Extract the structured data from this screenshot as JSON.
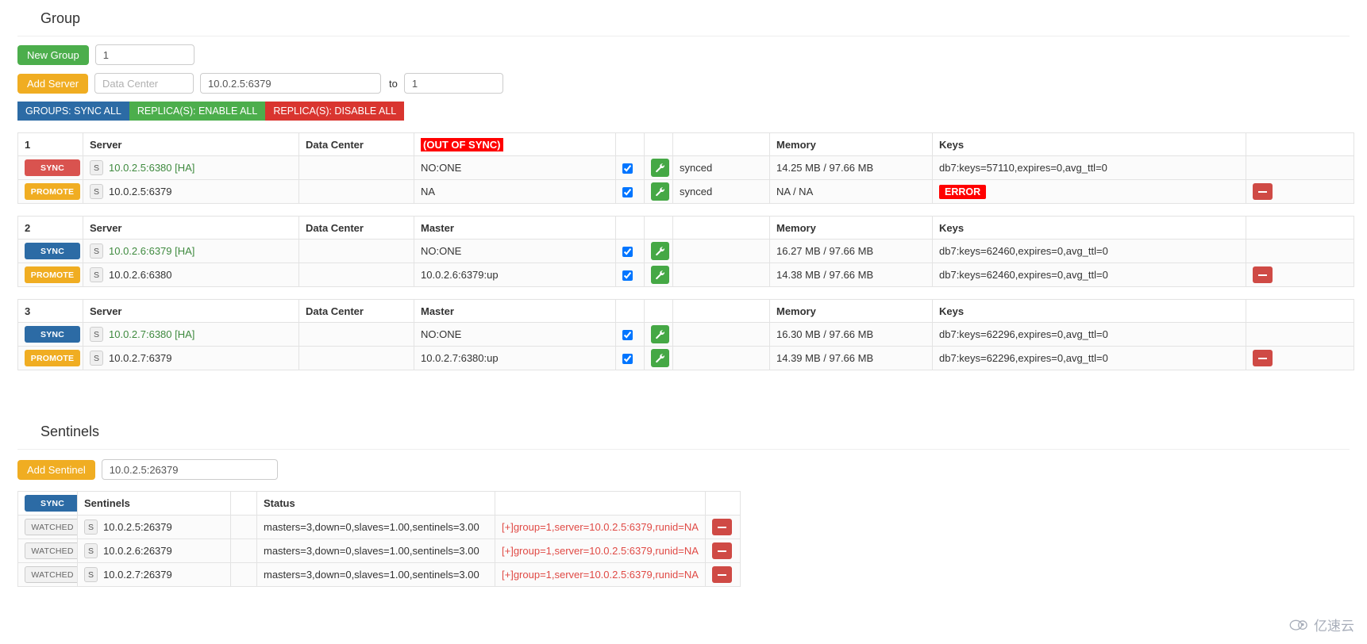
{
  "group_section": {
    "title": "Group",
    "new_group_label": "New Group",
    "new_group_value": "1",
    "add_server_label": "Add Server",
    "data_center_placeholder": "Data Center",
    "server_value": "10.0.2.5:6379",
    "to_label": "to",
    "to_value": "1",
    "bulk_actions": [
      {
        "label": "GROUPS: SYNC ALL",
        "color": "#2c6ba5"
      },
      {
        "label": "REPLICA(S): ENABLE ALL",
        "color": "#4cae4c"
      },
      {
        "label": "REPLICA(S): DISABLE ALL",
        "color": "#d9352f"
      }
    ]
  },
  "groups": [
    {
      "index": "1",
      "headers": {
        "server": "Server",
        "data_center": "Data Center",
        "master": "(OUT OF SYNC)",
        "master_is_alert": true,
        "blank1": "",
        "blank2": "",
        "blank3": "",
        "memory": "Memory",
        "keys": "Keys",
        "blank4": ""
      },
      "rows": [
        {
          "action": "SYNC",
          "action_color": "#d9534f",
          "badge": "S",
          "server": "10.0.2.5:6380 [HA]",
          "server_ha": true,
          "data_center": "",
          "master": "NO:ONE",
          "checked": true,
          "status": "synced",
          "memory": "14.25 MB / 97.66 MB",
          "keys": "db7:keys=57110,expires=0,avg_ttl=0",
          "keys_error": false,
          "deletable": false
        },
        {
          "action": "PROMOTE",
          "action_color": "#f0ad22",
          "badge": "S",
          "server": "10.0.2.5:6379",
          "server_ha": false,
          "data_center": "",
          "master": "NA",
          "checked": true,
          "status": "synced",
          "memory": "NA / NA",
          "keys": "ERROR",
          "keys_error": true,
          "deletable": true
        }
      ]
    },
    {
      "index": "2",
      "headers": {
        "server": "Server",
        "data_center": "Data Center",
        "master": "Master",
        "master_is_alert": false,
        "blank1": "",
        "blank2": "",
        "blank3": "",
        "memory": "Memory",
        "keys": "Keys",
        "blank4": ""
      },
      "rows": [
        {
          "action": "SYNC",
          "action_color": "#2c6ba5",
          "badge": "S",
          "server": "10.0.2.6:6379 [HA]",
          "server_ha": true,
          "data_center": "",
          "master": "NO:ONE",
          "checked": true,
          "status": "",
          "memory": "16.27 MB / 97.66 MB",
          "keys": "db7:keys=62460,expires=0,avg_ttl=0",
          "keys_error": false,
          "deletable": false
        },
        {
          "action": "PROMOTE",
          "action_color": "#f0ad22",
          "badge": "S",
          "server": "10.0.2.6:6380",
          "server_ha": false,
          "data_center": "",
          "master": "10.0.2.6:6379:up",
          "checked": true,
          "status": "",
          "memory": "14.38 MB / 97.66 MB",
          "keys": "db7:keys=62460,expires=0,avg_ttl=0",
          "keys_error": false,
          "deletable": true
        }
      ]
    },
    {
      "index": "3",
      "headers": {
        "server": "Server",
        "data_center": "Data Center",
        "master": "Master",
        "master_is_alert": false,
        "blank1": "",
        "blank2": "",
        "blank3": "",
        "memory": "Memory",
        "keys": "Keys",
        "blank4": ""
      },
      "rows": [
        {
          "action": "SYNC",
          "action_color": "#2c6ba5",
          "badge": "S",
          "server": "10.0.2.7:6380 [HA]",
          "server_ha": true,
          "data_center": "",
          "master": "NO:ONE",
          "checked": true,
          "status": "",
          "memory": "16.30 MB / 97.66 MB",
          "keys": "db7:keys=62296,expires=0,avg_ttl=0",
          "keys_error": false,
          "deletable": false
        },
        {
          "action": "PROMOTE",
          "action_color": "#f0ad22",
          "badge": "S",
          "server": "10.0.2.7:6379",
          "server_ha": false,
          "data_center": "",
          "master": "10.0.2.7:6380:up",
          "checked": true,
          "status": "",
          "memory": "14.39 MB / 97.66 MB",
          "keys": "db7:keys=62296,expires=0,avg_ttl=0",
          "keys_error": false,
          "deletable": true
        }
      ]
    }
  ],
  "sentinels_section": {
    "title": "Sentinels",
    "add_sentinel_label": "Add Sentinel",
    "add_sentinel_value": "10.0.2.5:26379",
    "headers": {
      "sync": "SYNC",
      "sentinels": "Sentinels",
      "gap": "",
      "status": "Status",
      "info": "",
      "del": ""
    },
    "rows": [
      {
        "action": "WATCHED",
        "badge": "S",
        "name": "10.0.2.5:26379",
        "status": "masters=3,down=0,slaves=1.00,sentinels=3.00",
        "info": "[+]group=1,server=10.0.2.5:6379,runid=NA"
      },
      {
        "action": "WATCHED",
        "badge": "S",
        "name": "10.0.2.6:26379",
        "status": "masters=3,down=0,slaves=1.00,sentinels=3.00",
        "info": "[+]group=1,server=10.0.2.5:6379,runid=NA"
      },
      {
        "action": "WATCHED",
        "badge": "S",
        "name": "10.0.2.7:26379",
        "status": "masters=3,down=0,slaves=1.00,sentinels=3.00",
        "info": "[+]group=1,server=10.0.2.5:6379,runid=NA"
      }
    ]
  },
  "watermark": {
    "text": "亿速云"
  }
}
